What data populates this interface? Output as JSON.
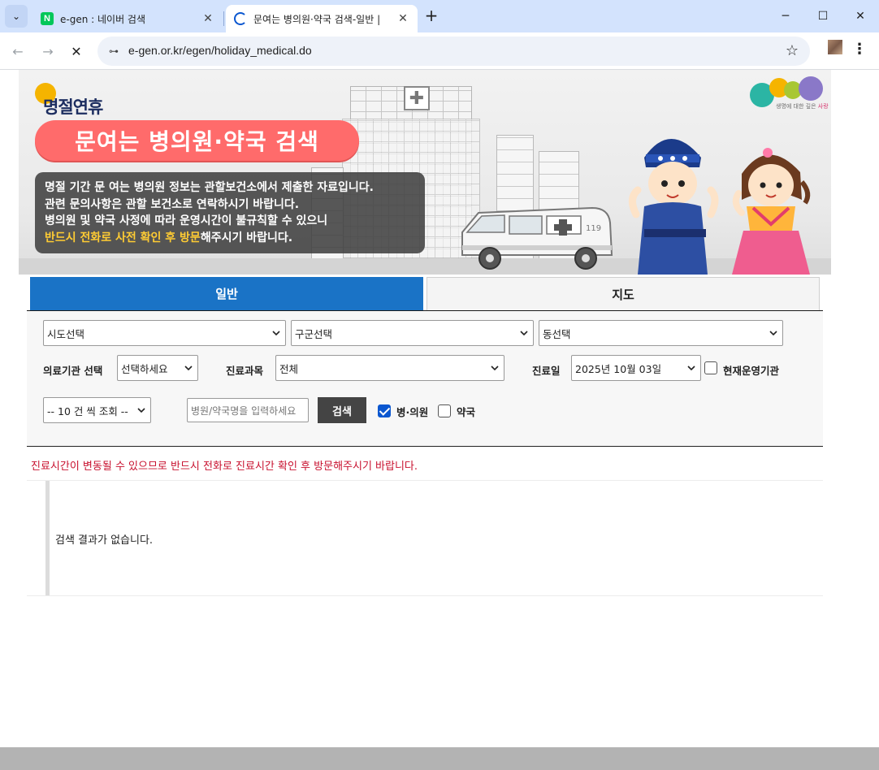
{
  "browser": {
    "tabs": [
      {
        "title": "e-gen : 네이버 검색",
        "favicon_text": "N",
        "active": false
      },
      {
        "title": "문여는 병의원·약국 검색-일반 | ",
        "active": true
      }
    ],
    "url": "e-gen.or.kr/egen/holiday_medical.do",
    "close_glyph": "✕",
    "new_tab_glyph": "+",
    "minimize_glyph": "─",
    "maximize_glyph": "☐",
    "close_window_glyph": "✕",
    "tab_menu_glyph": "⌄",
    "back_glyph": "←",
    "forward_glyph": "→",
    "stop_glyph": "✕",
    "site_info_glyph": "⊶",
    "star_glyph": "☆",
    "kebab_glyph": "⋮"
  },
  "banner": {
    "season": "명절연휴",
    "title": "문여는 병의원·약국 검색",
    "notice_lines": [
      "명절 기간 문 여는 병의원 정보는 관할보건소에서 제출한 자료입니다.",
      "관련 문의사항은 관할 보건소로 연락하시기 바랍니다.",
      "병의원 및 약국 사정에 따라 운영시간이 불규칙할 수 있으니"
    ],
    "notice_highlight": "반드시 전화로 사전 확인 후 방문",
    "notice_tail": "해주시기 바랍니다.",
    "logo_caption_prefix": "생명에 대한 깊은 ",
    "logo_caption_accent": "사랑",
    "colors": {
      "pill": "#ff6b6b",
      "highlight": "#ffcc33",
      "dot": "#f5b400"
    }
  },
  "tabs": {
    "general": "일반",
    "map": "지도"
  },
  "search": {
    "sido": "시도선택",
    "gugun": "구군선택",
    "dong": "동선택",
    "institution_label": "의료기관 선택",
    "institution_value": "선택하세요",
    "dept_label": "진료과목",
    "dept_value": "전체",
    "date_label": "진료일",
    "date_value": "2025년 10월 03일",
    "operating_now_label": "현재운영기관",
    "operating_now_checked": false,
    "page_size": "-- 10 건 씩 조회 --",
    "name_placeholder": "병원/약국명을 입력하세요",
    "search_button": "검색",
    "hospital_label": "병·의원",
    "hospital_checked": true,
    "pharmacy_label": "약국",
    "pharmacy_checked": false
  },
  "warning": "진료시간이 변동될 수 있으므로 반드시 전화로 진료시간 확인 후 방문해주시기 바랍니다.",
  "results": {
    "empty_message": "검색 결과가 없습니다."
  }
}
